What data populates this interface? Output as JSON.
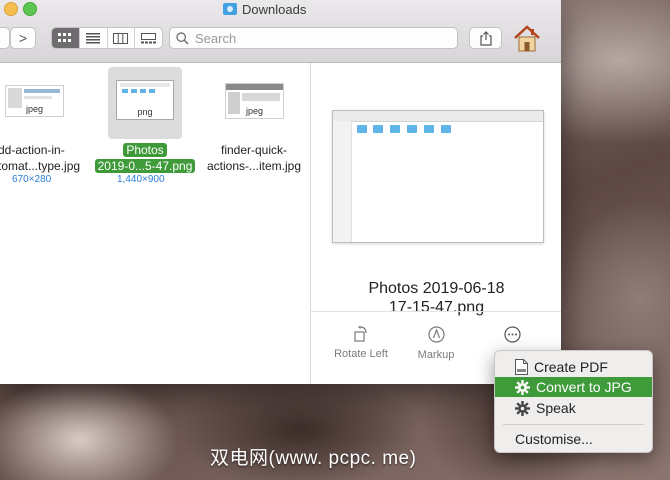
{
  "window": {
    "title": "Downloads"
  },
  "toolbar": {
    "back_label": "",
    "forward_label": ">",
    "search_placeholder": "Search"
  },
  "files": [
    {
      "name_line1": "dd-action-in-",
      "name_line2": "tomat...type.jpg",
      "dims": "670×280",
      "ext": "jpeg"
    },
    {
      "name_line1": "Photos",
      "name_line2": "2019-0...5-47.png",
      "dims": "1,440×900",
      "ext": "png"
    },
    {
      "name_line1": "finder-quick-",
      "name_line2": "actions-...item.jpg",
      "dims": "",
      "ext": "jpeg"
    }
  ],
  "preview": {
    "title_line1": "Photos 2019-06-18",
    "title_line2": "17-15-47.png",
    "actions": [
      {
        "label": "Rotate Left",
        "icon": "rotate-left-icon"
      },
      {
        "label": "Markup",
        "icon": "markup-icon"
      },
      {
        "label": "",
        "icon": "more-icon"
      }
    ]
  },
  "context_menu": {
    "items": [
      {
        "label": "Create PDF",
        "icon": "pdf-icon"
      },
      {
        "label": "Convert to JPG",
        "icon": "gear-icon"
      },
      {
        "label": "Speak",
        "icon": "gear-icon"
      }
    ],
    "customise_label": "Customise..."
  },
  "watermark": "双电网(www. pcpc. me)",
  "colors": {
    "selection": "#3f9a3a",
    "dims_blue": "#2d7fd3",
    "folder_blue": "#42a1e0"
  }
}
